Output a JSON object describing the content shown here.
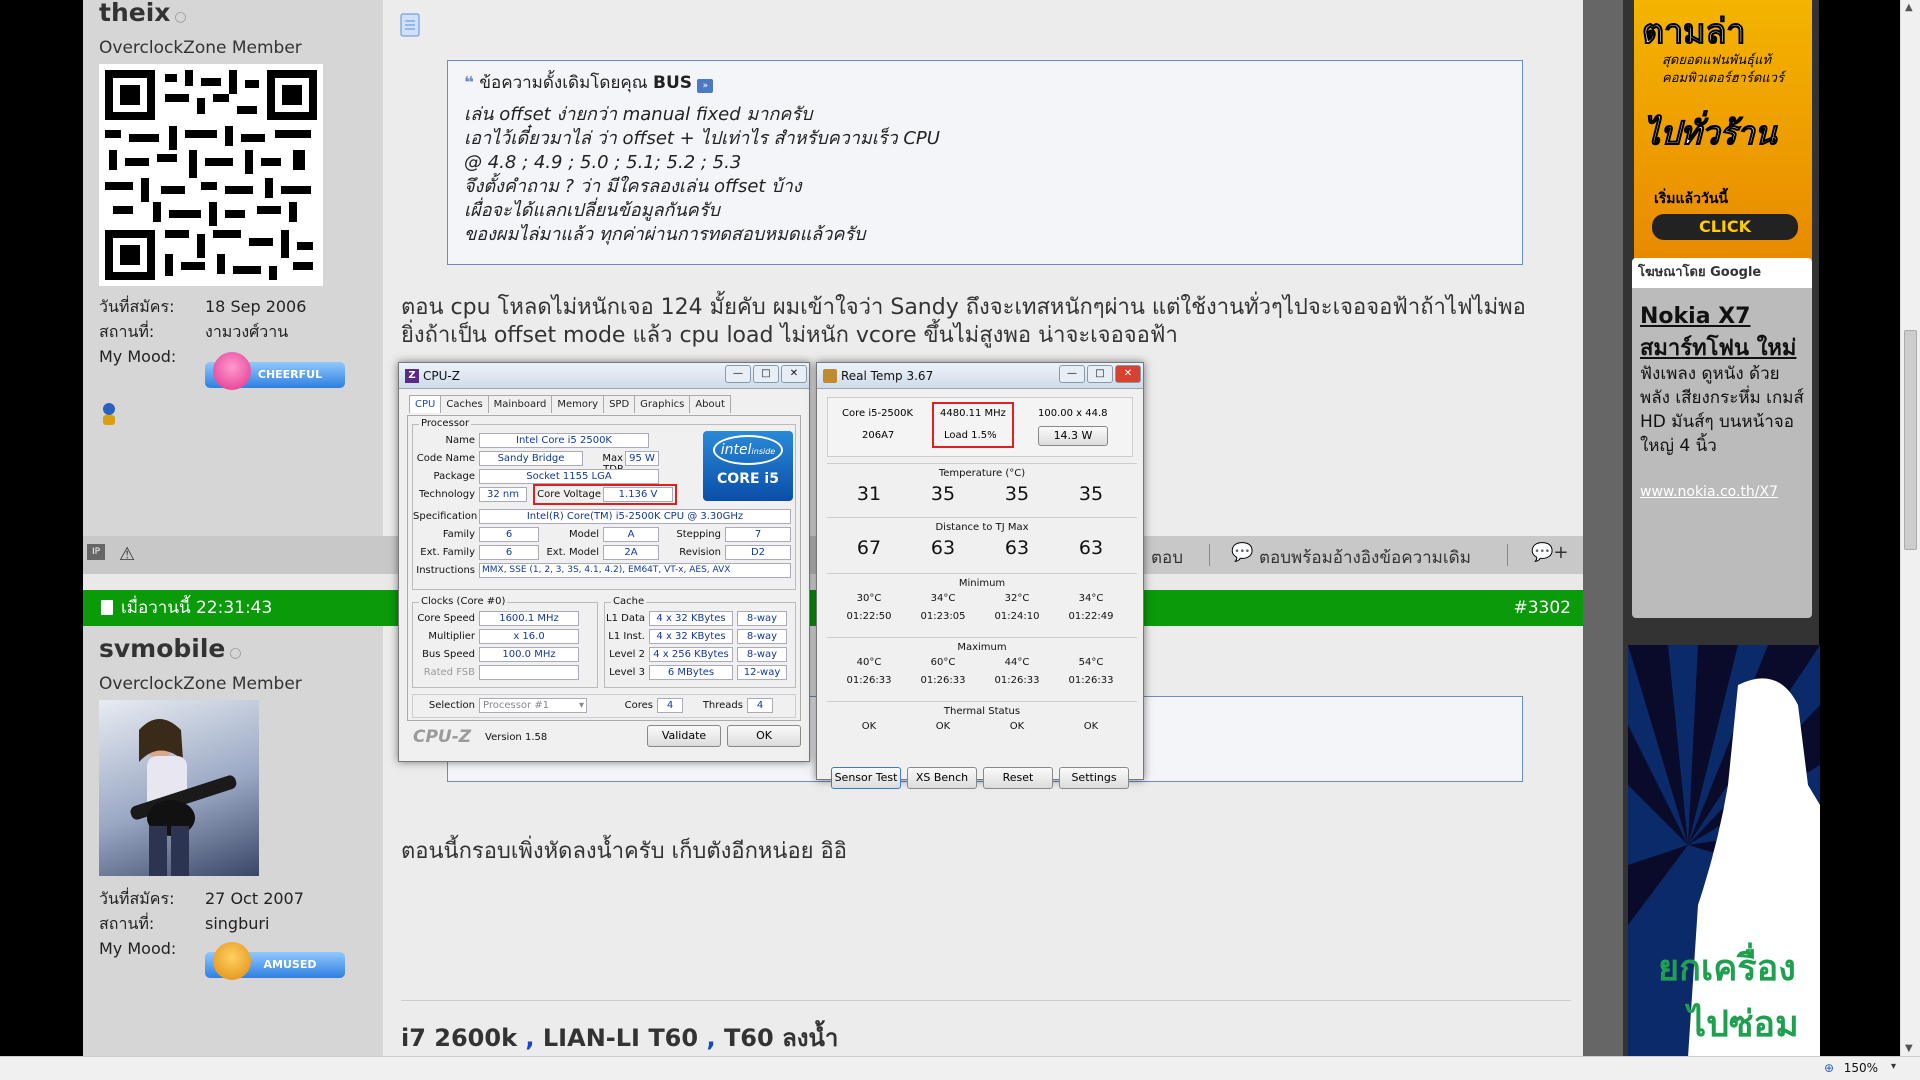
{
  "post1": {
    "username": "theix",
    "rank": "OverclockZone Member",
    "joined_label": "วันที่สมัคร:",
    "joined": "18 Sep 2006",
    "location_label": "สถานที่:",
    "location": "งามวงศ์วาน",
    "mood_label": "My Mood:",
    "mood": "CHEERFUL",
    "quote_header": "ข้อความดั้งเดิมโดยคุณ",
    "quote_author": "BUS",
    "quote_lines": [
      "เล่น offset ง่ายกว่า manual fixed มากครับ",
      "เอาไว้เดี๋ยวมาไล่ ว่า offset + ไปเท่าไร สำหรับความเร็ว CPU",
      "@ 4.8 ; 4.9 ; 5.0 ; 5.1; 5.2 ; 5.3",
      "จึงตั้งคำถาม ? ว่า มีใครลองเล่น offset บ้าง",
      "เผื่อจะได้แลกเปลี่ยนข้อมูลกันครับ",
      "ของผมไล่มาแล้ว ทุกค่าผ่านการทดสอบหมดแล้วครับ"
    ],
    "text_line1": "ตอน cpu โหลดไม่หนักเจอ 124 มั้ยคับ ผมเข้าใจว่า Sandy ถึงจะเทสหนักๆผ่าน แต่ใช้งานทั่วๆไปจะเจอจอฟ้าถ้าไฟไม่พอ",
    "text_line2": "ยิ่งถ้าเป็น offset mode แล้ว cpu load ไม่หนัก vcore ขึ้นไม่สูงพอ น่าจะเจอจอฟ้า",
    "reply_label": "ตอบ",
    "quote_reply_label": "ตอบพร้อมอ้างอิงข้อความเดิม"
  },
  "post2": {
    "date": "เมื่อวานนี้ 22:31:43",
    "number": "#3302",
    "username": "svmobile",
    "rank": "OverclockZone Member",
    "joined_label": "วันที่สมัคร:",
    "joined": "27 Oct 2007",
    "location_label": "สถานที่:",
    "location": "singburi",
    "mood_label": "My Mood:",
    "mood": "AMUSED",
    "text": "ตอนนี้กรอบเพิ่งหัดลงน้ำครับ เก็บตังอีกหน่อย อิอิ",
    "signature_a": "i7 2600k",
    "signature_sep": ",",
    "signature_b": "LIAN-LI T60",
    "signature_c": "T60 ลงน้ำ"
  },
  "cpuz": {
    "title": "CPU-Z",
    "tabs": [
      "CPU",
      "Caches",
      "Mainboard",
      "Memory",
      "SPD",
      "Graphics",
      "About"
    ],
    "processor_group": "Processor",
    "name_label": "Name",
    "name": "Intel Core i5 2500K",
    "codename_label": "Code Name",
    "codename": "Sandy Bridge",
    "maxtdp_label": "Max TDP",
    "maxtdp": "95 W",
    "package_label": "Package",
    "package": "Socket 1155 LGA",
    "tech_label": "Technology",
    "tech": "32 nm",
    "voltage_label": "Core Voltage",
    "voltage": "1.136 V",
    "spec_label": "Specification",
    "spec": "Intel(R) Core(TM) i5-2500K CPU @ 3.30GHz",
    "family_label": "Family",
    "family": "6",
    "model_label": "Model",
    "model": "A",
    "stepping_label": "Stepping",
    "stepping": "7",
    "extfamily_label": "Ext. Family",
    "extfamily": "6",
    "extmodel_label": "Ext. Model",
    "extmodel": "2A",
    "revision_label": "Revision",
    "revision": "D2",
    "instr_label": "Instructions",
    "instr": "MMX, SSE (1, 2, 3, 3S, 4.1, 4.2), EM64T, VT-x, AES, AVX",
    "clocks_group": "Clocks (Core #0)",
    "corespeed_label": "Core Speed",
    "corespeed": "1600.1 MHz",
    "mult_label": "Multiplier",
    "mult": "x 16.0",
    "bus_label": "Bus Speed",
    "bus": "100.0 MHz",
    "fsb_label": "Rated FSB",
    "cache_group": "Cache",
    "l1d_label": "L1 Data",
    "l1d": "4 x 32 KBytes",
    "l1d_way": "8-way",
    "l1i_label": "L1 Inst.",
    "l1i": "4 x 32 KBytes",
    "l1i_way": "8-way",
    "l2_label": "Level 2",
    "l2": "4 x 256 KBytes",
    "l2_way": "8-way",
    "l3_label": "Level 3",
    "l3": "6 MBytes",
    "l3_way": "12-way",
    "selection_label": "Selection",
    "selection": "Processor #1",
    "cores_label": "Cores",
    "cores": "4",
    "threads_label": "Threads",
    "threads": "4",
    "brand": "CPU-Z",
    "version": "Version 1.58",
    "validate": "Validate",
    "ok": "OK",
    "logo_intel": "intel",
    "logo_inside": "inside",
    "logo_core": "CORE i5"
  },
  "realtemp": {
    "title": "Real Temp 3.67",
    "cpu": "Core i5-2500K",
    "cpuid": "206A7",
    "freq": "4480.11 MHz",
    "load": "Load  1.5%",
    "ratio": "100.00 x 44.8",
    "power": "14.3 W",
    "temp_label": "Temperature (°C)",
    "temps": [
      "31",
      "35",
      "35",
      "35"
    ],
    "dist_label": "Distance to TJ Max",
    "dists": [
      "67",
      "63",
      "63",
      "63"
    ],
    "min_label": "Minimum",
    "mins": [
      "30°C",
      "34°C",
      "32°C",
      "34°C"
    ],
    "min_times": [
      "01:22:50",
      "01:23:05",
      "01:24:10",
      "01:22:49"
    ],
    "max_label": "Maximum",
    "maxs": [
      "40°C",
      "60°C",
      "44°C",
      "54°C"
    ],
    "max_times": [
      "01:26:33",
      "01:26:33",
      "01:26:33",
      "01:26:33"
    ],
    "status_label": "Thermal Status",
    "status": [
      "OK",
      "OK",
      "OK",
      "OK"
    ],
    "buttons": [
      "Sensor Test",
      "XS Bench",
      "Reset",
      "Settings"
    ]
  },
  "ads": {
    "ad1_title": "ตามล่า",
    "ad1_line": "สุดยอดแฟนพันธุ์แท้ คอมพิวเตอร์ฮาร์ดแวร์",
    "ad1_sub": "ไปทั่วร้าน",
    "ad1_start": "เริ่มแล้ววันนี้",
    "ad1_click": "CLICK",
    "google_label": "โฆษณาโดย Google",
    "nokia_title": "Nokia X7",
    "nokia_sub": "สมาร์ทโฟน ใหม่",
    "nokia_body": "ฟังเพลง ดูหนัง ด้วยพลัง เสียงกระหึ่ม เกมส์ HD มันส์ๆ บนหน้าจอใหญ่ 4 นิ้ว",
    "nokia_link": "www.nokia.co.th/X7",
    "ad3_line1": "ยกเครื่อง",
    "ad3_line2": "ไปซ่อม"
  },
  "status": {
    "zoom": "150%"
  }
}
